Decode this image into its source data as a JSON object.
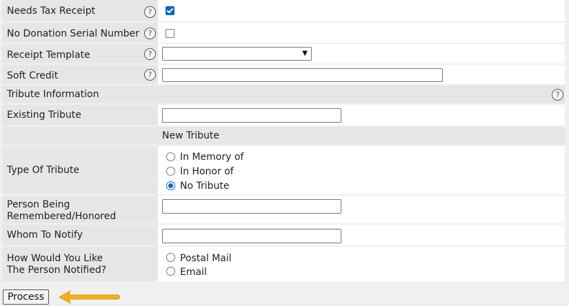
{
  "form": {
    "needs_tax_receipt": {
      "label": "Needs Tax Receipt",
      "checked": true
    },
    "no_donation_serial": {
      "label": "No Donation Serial Number",
      "checked": false
    },
    "receipt_template": {
      "label": "Receipt Template",
      "value": ""
    },
    "soft_credit": {
      "label": "Soft Credit",
      "value": ""
    },
    "tribute_info": {
      "label": "Tribute Information"
    },
    "existing_tribute": {
      "label": "Existing Tribute",
      "value": ""
    },
    "new_tribute": {
      "label": "New Tribute"
    },
    "type_of_tribute": {
      "label": "Type Of Tribute",
      "options": [
        "In Memory of",
        "In Honor of",
        "No Tribute"
      ],
      "selected": "No Tribute"
    },
    "person_remembered": {
      "label_line1": "Person Being",
      "label_line2": "Remembered/Honored",
      "value": ""
    },
    "whom_to_notify": {
      "label": "Whom To Notify",
      "value": ""
    },
    "notify_method": {
      "label_line1": "How Would You Like",
      "label_line2": "The Person Notified?",
      "options": [
        "Postal Mail",
        "Email"
      ],
      "selected": ""
    }
  },
  "help_glyph": "?",
  "process_label": "Process",
  "colors": {
    "arrow": "#f2b01e",
    "accent": "#0a66d8",
    "label_bg": "#e6e6e6"
  }
}
